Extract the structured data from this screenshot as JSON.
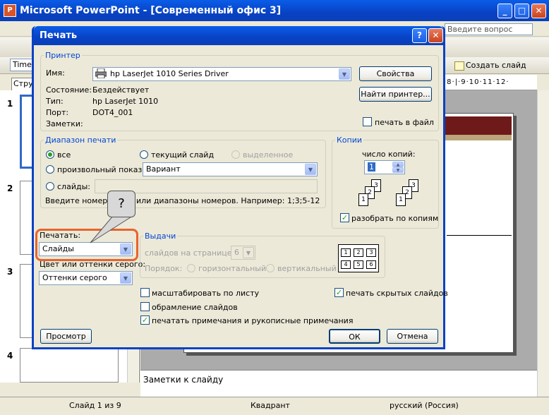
{
  "app": {
    "title": "Microsoft PowerPoint - [Современный офис 3]",
    "icon_letter": "P",
    "ask_question_placeholder": "Введите вопрос",
    "font_name": "Times",
    "create_slide_label": "Создать слайд",
    "outline_tab_label": "Струк",
    "ruler_text": "·8·|·9·10·11·12·",
    "slide_numbers": [
      "1",
      "2",
      "3",
      "4"
    ],
    "notes_placeholder": "Заметки к слайду"
  },
  "statusbar": {
    "slide_info": "Слайд 1 из 9",
    "design": "Квадрант",
    "language": "русский (Россия)"
  },
  "dialog": {
    "title": "Печать",
    "help_button": "?",
    "close_button": "✕",
    "printer": {
      "group_label": "Принтер",
      "name_label": "Имя:",
      "name_value": "hp LaserJet 1010 Series Driver",
      "status_label": "Состояние:",
      "status_value": "Бездействует",
      "type_label": "Тип:",
      "type_value": "hp LaserJet 1010",
      "port_label": "Порт:",
      "port_value": "DOT4_001",
      "notes_label": "Заметки:",
      "properties_button": "Свойства",
      "find_printer_button": "Найти принтер...",
      "print_to_file_label": "печать в файл",
      "print_to_file_checked": false
    },
    "range": {
      "group_label": "Диапазон печати",
      "all_label": "все",
      "current_slide_label": "текущий слайд",
      "selection_label": "выделенное",
      "custom_show_label": "произвольный показ:",
      "custom_show_value": "Вариант",
      "slides_label": "слайды:",
      "slides_value": "",
      "hint_text": "Введите номера с",
      "hint_text_2": "или диапазоны номеров. Например: 1;3;5-12",
      "selected": "all"
    },
    "copies": {
      "group_label": "Копии",
      "count_label": "число копий:",
      "count_value": "1",
      "collate_label": "разобрать по копиям",
      "collate_checked": true,
      "stack_pages": [
        "1",
        "2",
        "3"
      ]
    },
    "print_what": {
      "label": "Печатать:",
      "value": "Слайды"
    },
    "color": {
      "label": "Цвет или оттенки серого:",
      "value": "Оттенки серого"
    },
    "handouts": {
      "group_label": "Выдачи",
      "per_page_label": "слайдов на странице:",
      "per_page_value": "6",
      "order_label": "Порядок:",
      "horizontal_label": "горизонтальный",
      "vertical_label": "вертикальный",
      "grid_cells": [
        "1",
        "2",
        "3",
        "4",
        "5",
        "6"
      ]
    },
    "options": {
      "scale_label": "масштабировать по листу",
      "scale_checked": false,
      "frame_label": "обрамление слайдов",
      "frame_checked": false,
      "notes_label": "печатать примечания и рукописные примечания",
      "notes_checked": true,
      "hidden_label": "печать скрытых слайдов",
      "hidden_checked": true
    },
    "preview_button": "Просмотр",
    "ok_button": "ОК",
    "cancel_button": "Отмена"
  },
  "callout": {
    "text": "?"
  },
  "colors": {
    "title_bar": "#0842c4",
    "group_label": "#0046d5",
    "highlight": "#e8642c",
    "slide_accent": "#6e1a1a"
  }
}
